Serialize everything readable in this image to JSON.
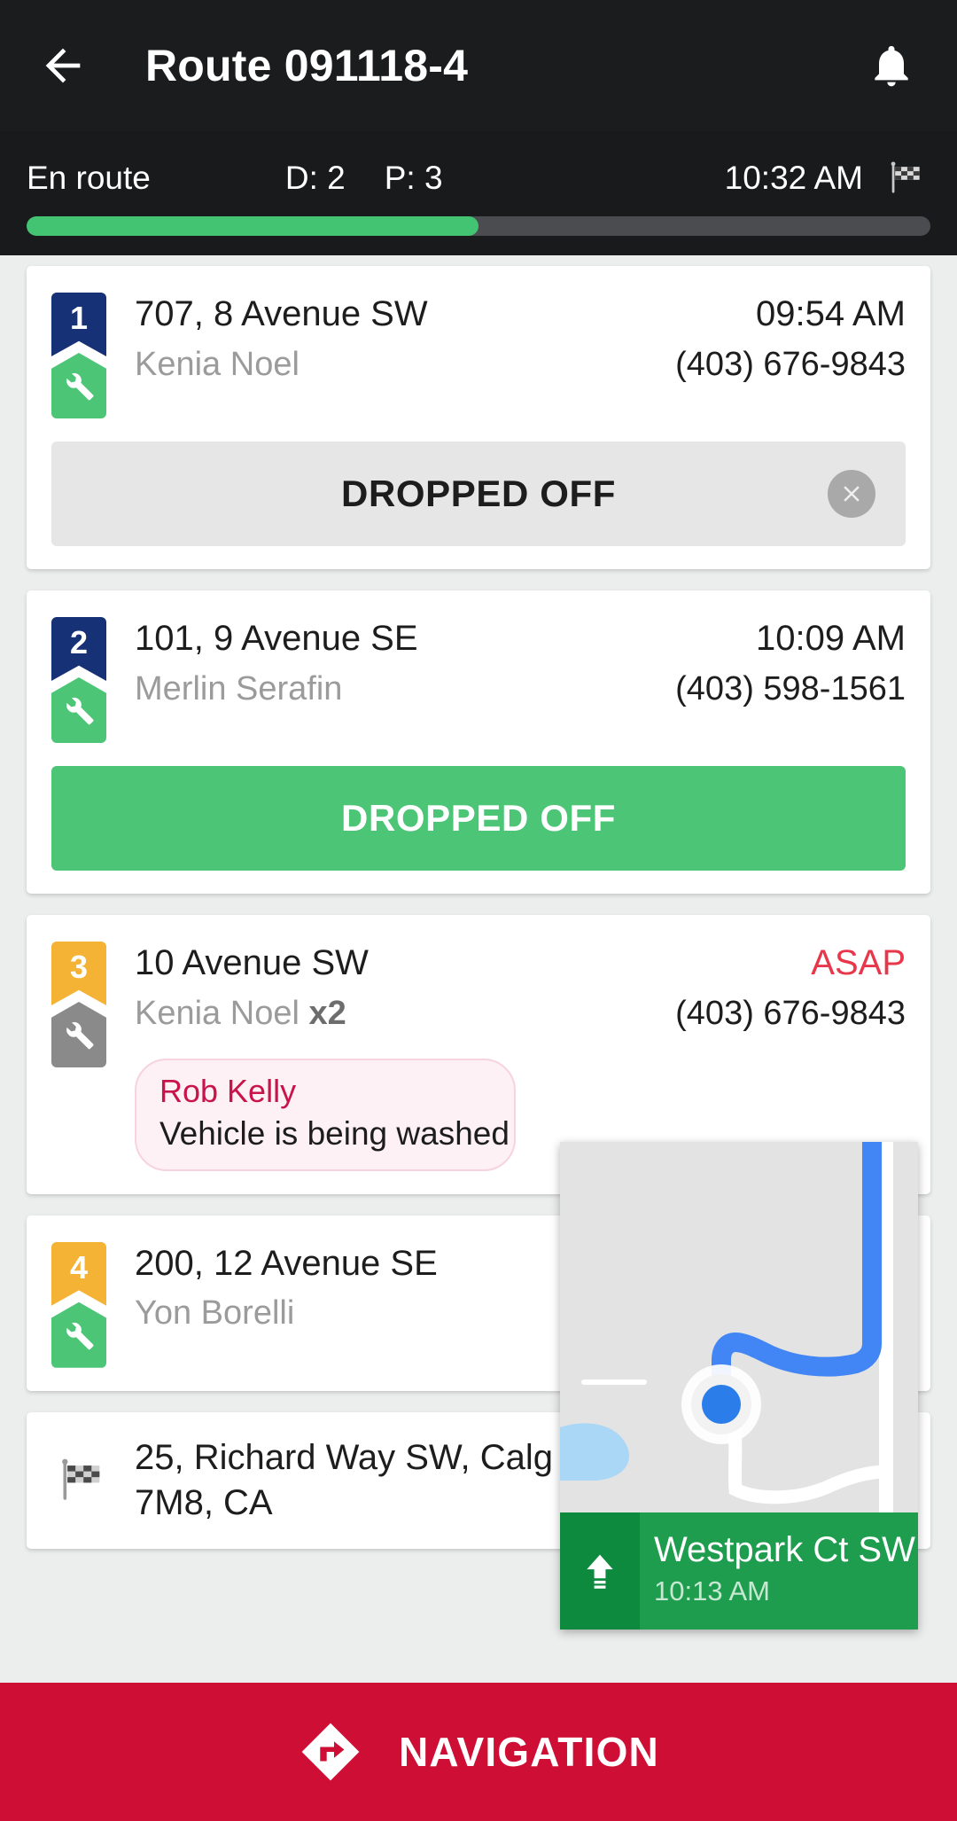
{
  "header": {
    "back_icon": "arrow-left-icon",
    "title": "Route 091118-4",
    "bell_icon": "bell-icon"
  },
  "status": {
    "state_label": "En route",
    "deliveries_label": "D: 2",
    "pickups_label": "P: 3",
    "time": "10:32 AM",
    "flag_icon": "checkered-flag-icon",
    "progress_percent": 50
  },
  "stops": [
    {
      "number": "1",
      "badge_color": "#173177",
      "service_icon": "wrench-icon",
      "service_color": "#4cc576",
      "address": "707, 8 Avenue SW",
      "eta": "09:54 AM",
      "eta_type": "time",
      "customer": "Kenia Noel",
      "customer_count": "",
      "phone": "(403) 676-9843",
      "action_label": "DROPPED OFF",
      "action_style": "done-grey",
      "has_clear": true,
      "clear_icon": "close-circle-icon"
    },
    {
      "number": "2",
      "badge_color": "#173177",
      "service_icon": "wrench-icon",
      "service_color": "#4cc576",
      "address": "101, 9 Avenue SE",
      "eta": "10:09 AM",
      "eta_type": "time",
      "customer": "Merlin Serafin",
      "customer_count": "",
      "phone": "(403) 598-1561",
      "action_label": "DROPPED OFF",
      "action_style": "done-green",
      "has_clear": false
    },
    {
      "number": "3",
      "badge_color": "#f5b335",
      "service_icon": "wrench-icon",
      "service_color": "#8a8a8a",
      "address": "10 Avenue SW",
      "eta": "ASAP",
      "eta_type": "asap",
      "customer": "Kenia Noel",
      "customer_count": "x2",
      "phone": "(403) 676-9843",
      "note_author": "Rob Kelly",
      "note_text": "Vehicle is being washed"
    },
    {
      "number": "4",
      "badge_color": "#f5b335",
      "service_icon": "wrench-icon",
      "service_color": "#4cc576",
      "address": "200, 12 Avenue SE",
      "eta": "",
      "eta_type": "none",
      "customer": "Yon Borelli",
      "customer_count": "",
      "phone": ""
    }
  ],
  "destination": {
    "flag_icon": "checkered-flag-icon",
    "address_line1": "25, Richard Way SW, Calg",
    "address_line2": "7M8, CA"
  },
  "map_widget": {
    "location_dot_icon": "current-location-dot",
    "direction_icon": "arrow-up-icon",
    "street": "Westpark Ct SW",
    "time": "10:13 AM",
    "route_color": "#4285f4",
    "banner_color": "#1f9d4e"
  },
  "bottom_bar": {
    "nav_icon": "navigation-arrow-icon",
    "label": "NAVIGATION",
    "color": "#ce0e35"
  }
}
